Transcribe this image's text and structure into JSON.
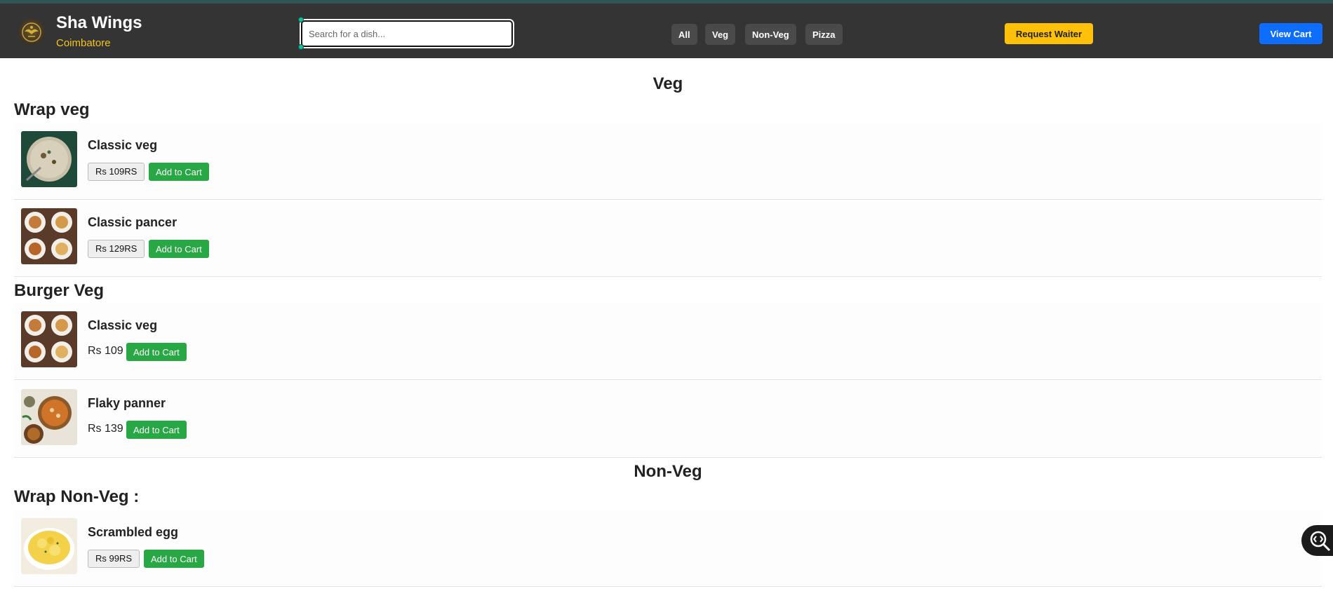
{
  "header": {
    "brand": "Sha Wings",
    "location": "Coimbatore",
    "search_placeholder": "Search for a dish...",
    "filters": [
      "All",
      "Veg",
      "Non-Veg",
      "Pizza"
    ],
    "request_waiter": "Request Waiter",
    "view_cart": "View Cart"
  },
  "menu": {
    "veg": {
      "title": "Veg",
      "wrap_veg": {
        "title": "Wrap veg",
        "items": [
          {
            "name": "Classic veg",
            "price": "Rs 109RS",
            "button": "Add to Cart"
          },
          {
            "name": "Classic pancer",
            "price": "Rs 129RS",
            "button": "Add to Cart"
          }
        ]
      },
      "burger_veg": {
        "title": "Burger Veg",
        "items": [
          {
            "name": "Classic veg",
            "price": "Rs 109",
            "button": "Add to Cart"
          },
          {
            "name": "Flaky panner",
            "price": "Rs 139",
            "button": "Add to Cart"
          }
        ]
      }
    },
    "nonveg": {
      "title": "Non-Veg",
      "wrap_nonveg": {
        "title": "Wrap Non-Veg :",
        "items": [
          {
            "name": "Scrambled egg",
            "price": "Rs 99RS",
            "button": "Add to Cart"
          }
        ]
      }
    }
  },
  "colors": {
    "navbar": "#343434",
    "accent_yellow": "#ffc107",
    "accent_blue": "#0d6efd",
    "add_green": "#28a745"
  },
  "icons": [
    "logo-emblem",
    "code-search-icon"
  ]
}
